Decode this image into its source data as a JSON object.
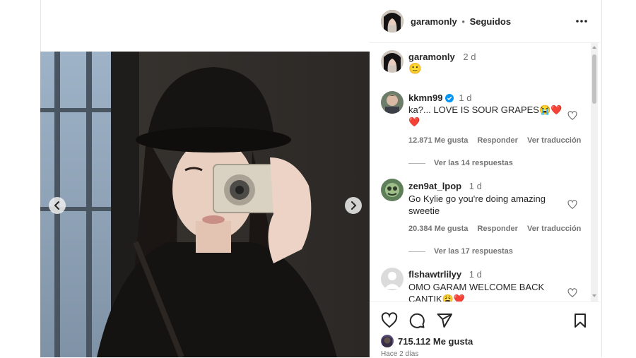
{
  "header": {
    "username": "garamonly",
    "separator": "•",
    "follow_state": "Seguidos",
    "more_icon": "more-horizontal-icon"
  },
  "caption": {
    "username": "garamonly",
    "time": "2 d",
    "text": "🙂"
  },
  "comments": [
    {
      "username": "kkmn99",
      "verified": true,
      "time": "1 d",
      "line1": "ka?... LOVE IS SOUR GRAPES😭❤️",
      "line2": "❤️",
      "likes": "12.871 Me gusta",
      "reply": "Responder",
      "translate": "Ver traducción",
      "view_replies": "Ver las 14 respuestas"
    },
    {
      "username": "zen9at_lpop",
      "verified": false,
      "time": "1 d",
      "line1": "Go Kylie go you're doing amazing",
      "line2": "sweetie",
      "likes": "20.384 Me gusta",
      "reply": "Responder",
      "translate": "Ver traducción",
      "view_replies": "Ver las 17 respuestas"
    },
    {
      "username": "flshawtrlilyy",
      "verified": false,
      "time": "1 d",
      "line1": "OMO GARAM WELCOME BACK",
      "line2": "CANTIK😩❤️"
    }
  ],
  "actions": {
    "like_icon": "heart-icon",
    "comment_icon": "comment-icon",
    "share_icon": "send-icon",
    "save_icon": "bookmark-icon",
    "likes": "715.112 Me gusta",
    "date": "Hace 2 días"
  },
  "colors": {
    "text": "#262626",
    "muted": "#737373",
    "verified": "#0095f6",
    "border": "#efefef"
  }
}
